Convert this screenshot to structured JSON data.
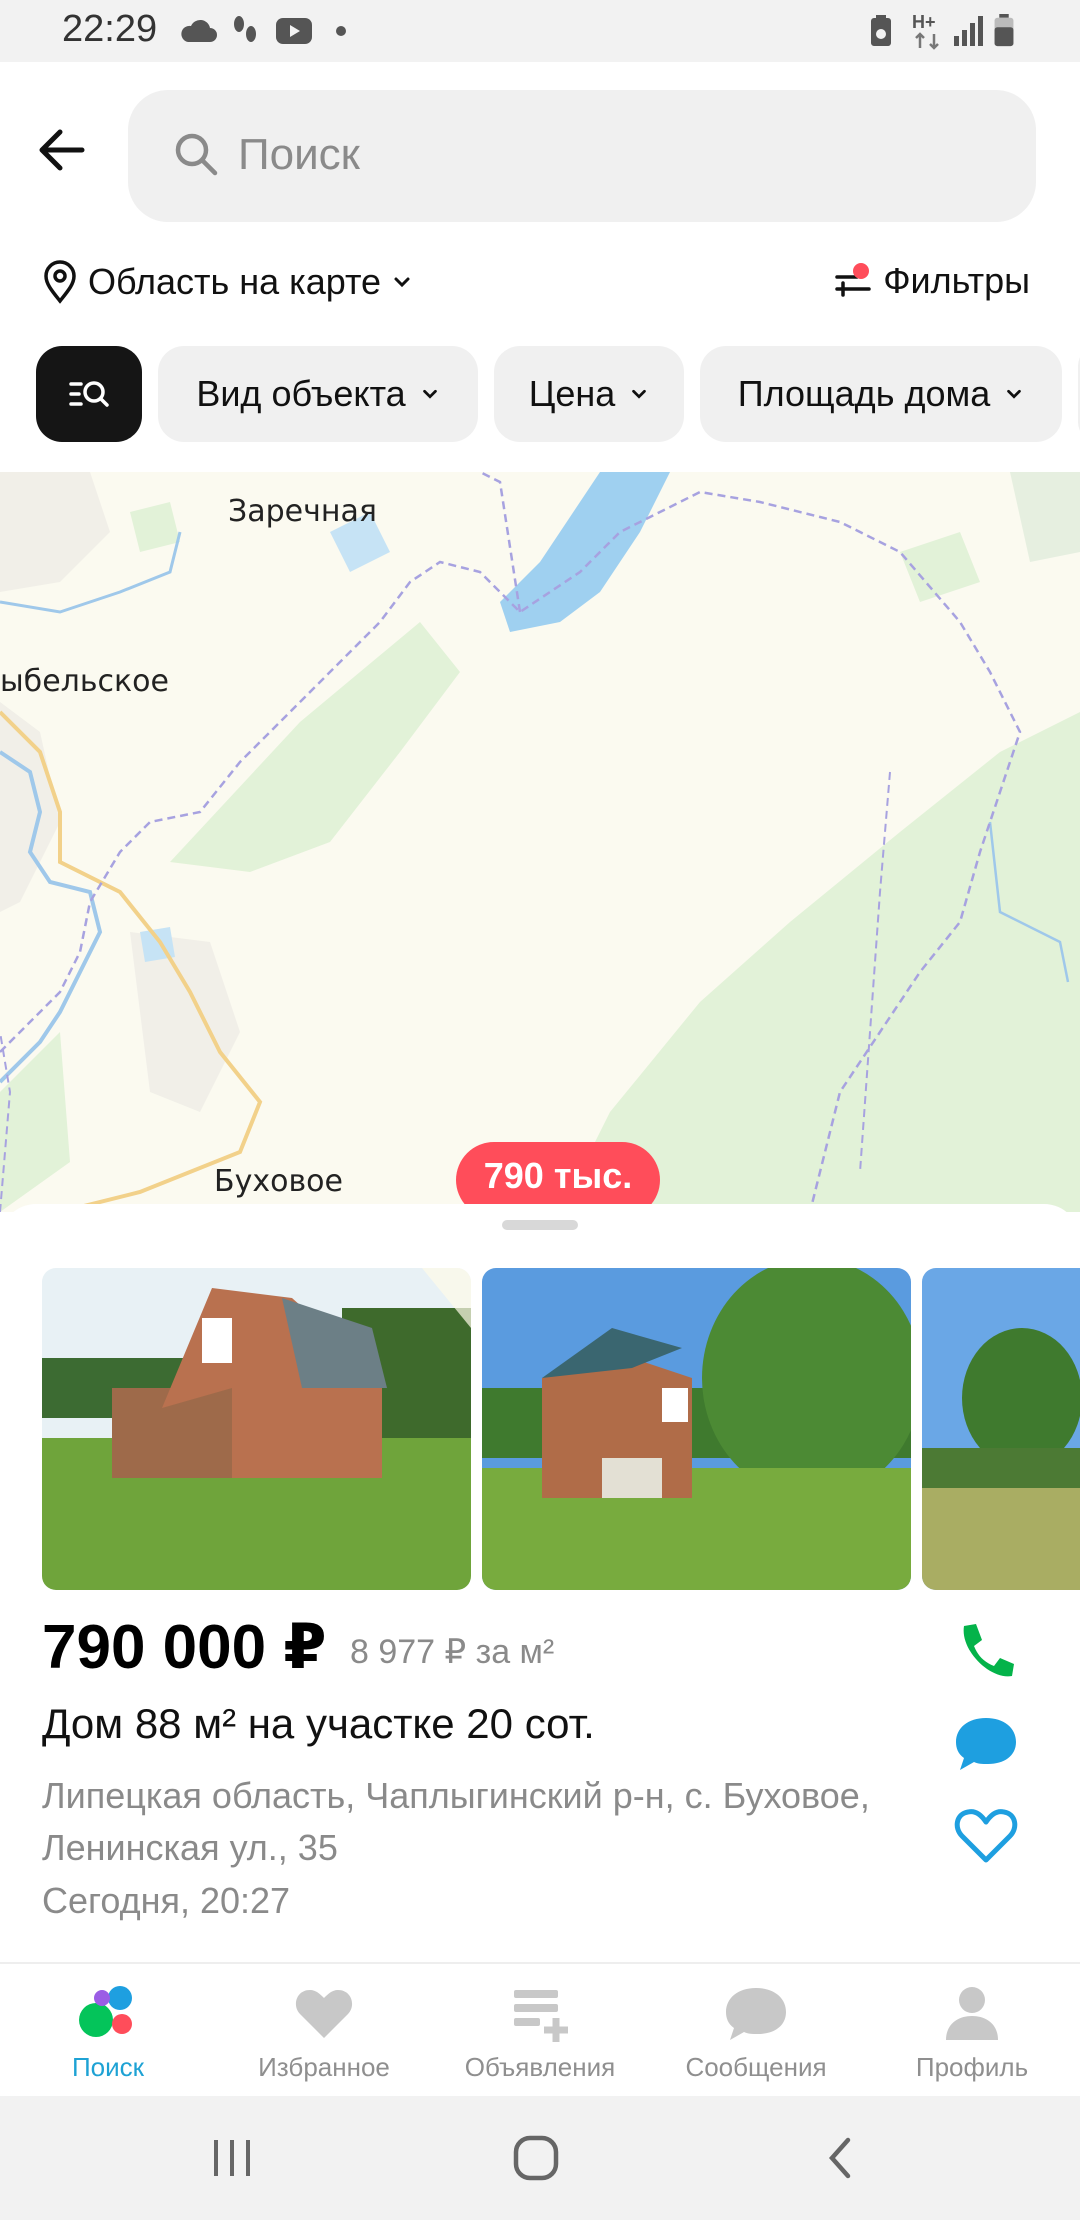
{
  "status_bar": {
    "time": "22:29",
    "network_label": "H+",
    "icons": [
      "cloud-icon",
      "footsteps-icon",
      "youtube-icon",
      "dot-icon",
      "battery-saver-icon",
      "network-icon",
      "signal-icon",
      "battery-icon"
    ]
  },
  "header": {
    "search_placeholder": "Поиск",
    "area_label": "Область на карте",
    "filters_label": "Фильтры"
  },
  "chips": [
    {
      "label": "Вид объекта"
    },
    {
      "label": "Цена"
    },
    {
      "label": "Площадь дома"
    }
  ],
  "map": {
    "labels": {
      "zarechnaya": "Заречная",
      "village_left": "ыбельское",
      "bukhovoe": "Буховое"
    },
    "price_pin": "790 тыс.",
    "colors": {
      "land": "#fbfaf0",
      "forest": "#e2f2d8",
      "water": "#9fd0f0",
      "border": "#a7a2e0",
      "pin": "#ff4d5a"
    }
  },
  "listing": {
    "price": "790 000 ₽",
    "price_per_m2": "8 977 ₽ за м²",
    "title": "Дом 88 м² на участке 20 сот.",
    "address": "Липецкая область, Чаплыгинский р-н, с. Буховое, Ленинская ул., 35",
    "date": "Сегодня, 20:27",
    "photos": [
      "photo-house-1",
      "photo-house-2",
      "photo-yard-3"
    ]
  },
  "nav": [
    {
      "label": "Поиск",
      "icon": "search-dots-icon",
      "active": true
    },
    {
      "label": "Избранное",
      "icon": "heart-icon",
      "active": false
    },
    {
      "label": "Объявления",
      "icon": "add-listing-icon",
      "active": false
    },
    {
      "label": "Сообщения",
      "icon": "chat-icon",
      "active": false
    },
    {
      "label": "Профиль",
      "icon": "person-icon",
      "active": false
    }
  ],
  "accent_color": "#1ea2d4"
}
